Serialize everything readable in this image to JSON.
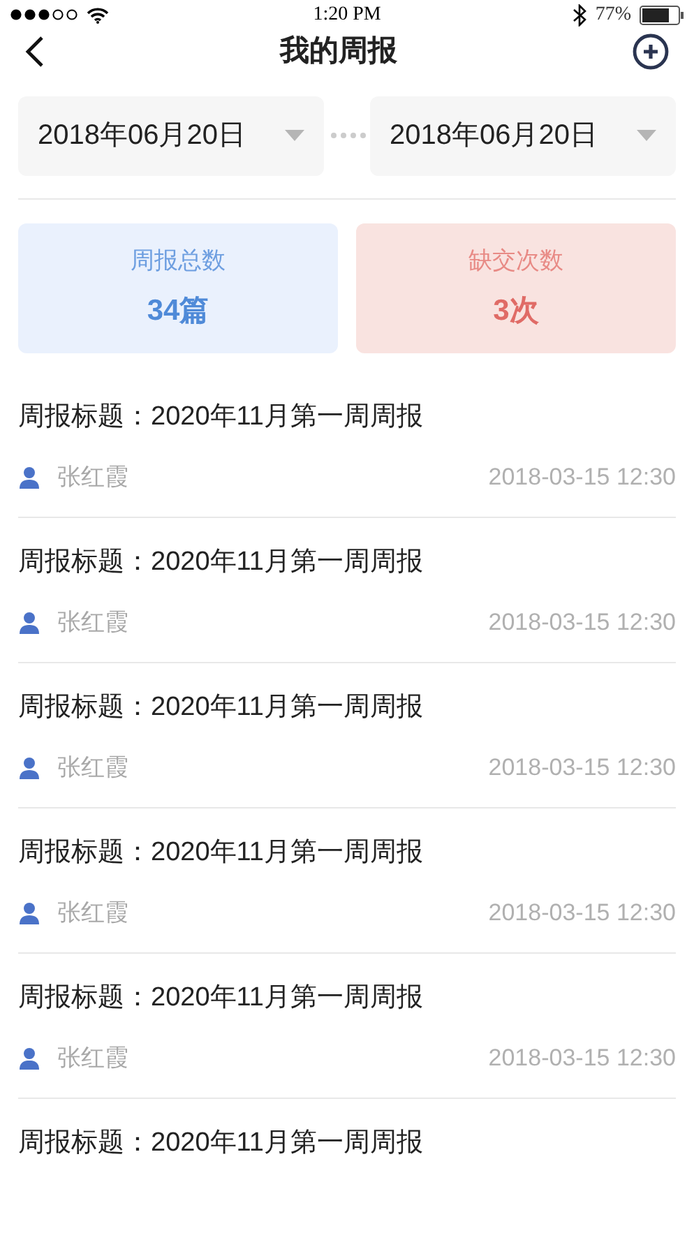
{
  "status_bar": {
    "time": "1:20 PM",
    "battery": "77%"
  },
  "nav": {
    "title": "我的周报"
  },
  "date_range": [
    {
      "value": "2018年06月20日"
    },
    {
      "value": "2018年06月20日"
    }
  ],
  "stats": [
    {
      "kind": "total",
      "label": "周报总数",
      "value": "34篇"
    },
    {
      "kind": "missed",
      "label": "缺交次数",
      "value": "3次"
    }
  ],
  "reports": [
    {
      "title": "周报标题：2020年11月第一周周报",
      "author": "张红霞",
      "time": "2018-03-15 12:30"
    },
    {
      "title": "周报标题：2020年11月第一周周报",
      "author": "张红霞",
      "time": "2018-03-15 12:30"
    },
    {
      "title": "周报标题：2020年11月第一周周报",
      "author": "张红霞",
      "time": "2018-03-15 12:30"
    },
    {
      "title": "周报标题：2020年11月第一周周报",
      "author": "张红霞",
      "time": "2018-03-15 12:30"
    },
    {
      "title": "周报标题：2020年11月第一周周报",
      "author": "张红霞",
      "time": "2018-03-15 12:30"
    },
    {
      "title": "周报标题：2020年11月第一周周报"
    }
  ]
}
